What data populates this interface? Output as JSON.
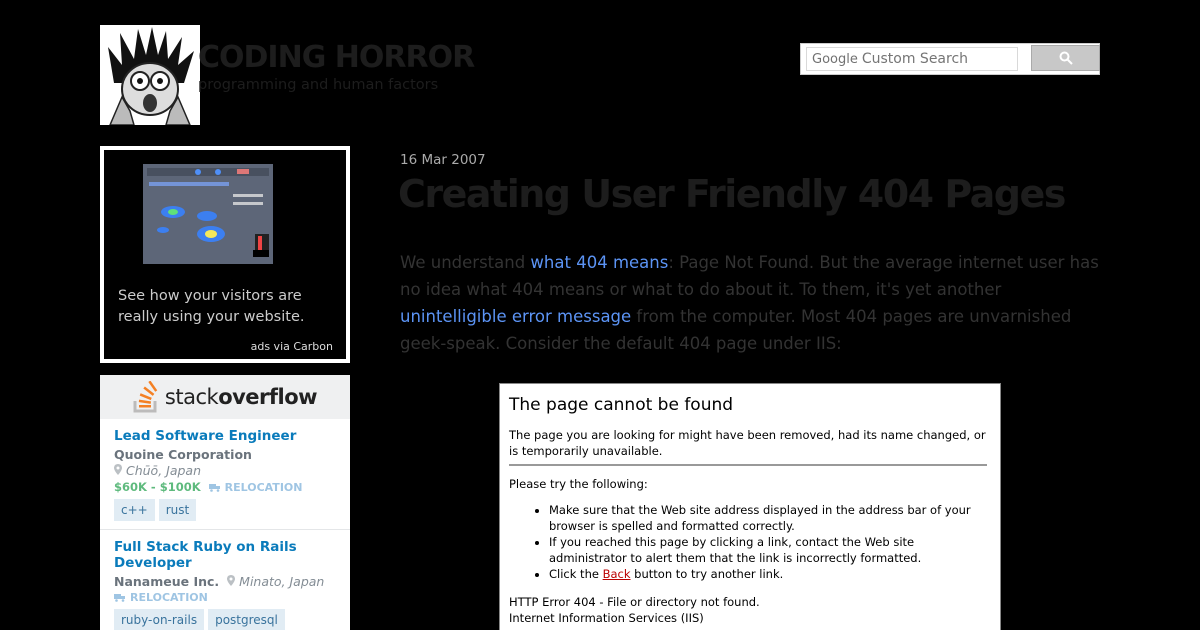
{
  "header": {
    "site_title": "CODING HORROR",
    "tagline": "programming and human factors",
    "search": {
      "brand": "Google",
      "placeholder": "Custom Search"
    }
  },
  "sidebar": {
    "ad": {
      "text": "See how your visitors are really using your website.",
      "via": "ads via Carbon"
    },
    "jobs_brand": {
      "part1": "stack",
      "part2": "overflow"
    },
    "jobs": [
      {
        "title": "Lead Software Engineer",
        "company": "Quoine Corporation",
        "location": "Chūō, Japan",
        "salary": "$60K - $100K",
        "relocation": "RELOCATION",
        "tags": [
          "c++",
          "rust"
        ]
      },
      {
        "title": "Full Stack Ruby on Rails Developer",
        "company": "Nanameue Inc.",
        "location": "Minato, Japan",
        "relocation": "RELOCATION",
        "tags": [
          "ruby-on-rails",
          "postgresql"
        ]
      }
    ]
  },
  "article": {
    "date": "16 Mar 2007",
    "title": "Creating User Friendly 404 Pages",
    "p_part1": "We understand ",
    "link1": "what 404 means",
    "p_part2": ": Page Not Found. But the average internet user has no idea what 404 means or what to do about it. To them, it's yet another ",
    "link2": "unintelligible error message",
    "p_part3": " from the computer. Most 404 pages are unvarnished geek-speak. Consider the default 404 page under IIS:"
  },
  "iis_page": {
    "heading": "The page cannot be found",
    "intro": "The page you are looking for might have been removed, had its name changed, or is temporarily unavailable.",
    "try": "Please try the following:",
    "item1": "Make sure that the Web site address displayed in the address bar of your browser is spelled and formatted correctly.",
    "item2": "If you reached this page by clicking a link, contact the Web site administrator to alert them that the link is incorrectly formatted.",
    "item3_pre": "Click the ",
    "item3_link": "Back",
    "item3_post": " button to try another link.",
    "error_line": "HTTP Error 404 - File or directory not found.",
    "server_line": "Internet Information Services (IIS)"
  },
  "colors": {
    "background": "#000000",
    "link": "#5c94f5",
    "job_title": "#0a7bbb",
    "salary": "#5eba7d"
  }
}
